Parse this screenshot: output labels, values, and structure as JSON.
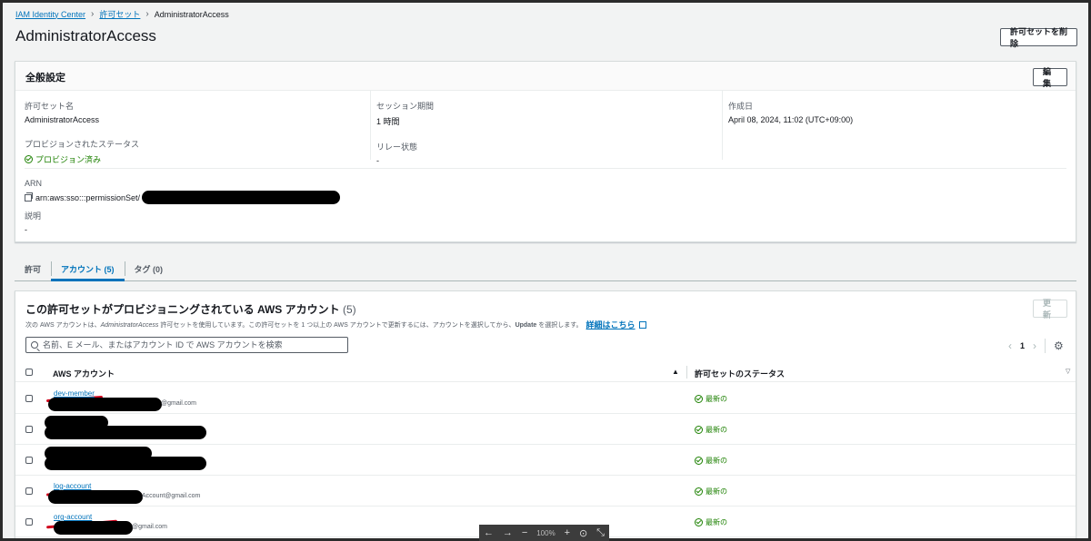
{
  "breadcrumb": {
    "root": "IAM Identity Center",
    "parent": "許可セット",
    "current": "AdministratorAccess"
  },
  "page": {
    "title": "AdministratorAccess",
    "delete_button": "許可セットを削除"
  },
  "general": {
    "title": "全般設定",
    "edit_button": "編集",
    "permission_set_name_label": "許可セット名",
    "permission_set_name": "AdministratorAccess",
    "provisioned_status_label": "プロビジョンされたステータス",
    "provisioned_status": "プロビジョン済み",
    "session_duration_label": "セッション期間",
    "session_duration": "1 時間",
    "relay_state_label": "リレー状態",
    "relay_state": "-",
    "created_label": "作成日",
    "created": "April 08, 2024, 11:02 (UTC+09:00)",
    "arn_label": "ARN",
    "arn_prefix": "arn:aws:sso:::permissionSet/",
    "description_label": "説明",
    "description": "-"
  },
  "tabs": [
    {
      "label": "許可",
      "active": false
    },
    {
      "label": "アカウント (5)",
      "active": true
    },
    {
      "label": "タグ (0)",
      "active": false
    }
  ],
  "accounts": {
    "title": "この許可セットがプロビジョニングされている AWS アカウント",
    "count": "(5)",
    "refresh_button": "更新",
    "desc_before": "次の AWS アカウントは、",
    "desc_name": "AdministratorAccess",
    "desc_after": " 許可セットを使用しています。この許可セットを 1 つ以上の AWS アカウントで更新するには、アカウントを選択してから、",
    "desc_update": "Update",
    "desc_end": " を選択します。",
    "more_link": "詳細はこちら",
    "search_placeholder": "名前、E メール、またはアカウント ID で AWS アカウントを検索",
    "page_number": "1",
    "col_account": "AWS アカウント",
    "col_status": "許可セットのステータス",
    "rows": [
      {
        "name": "dev-member",
        "email": "@gmail.com",
        "status": "最新の"
      },
      {
        "name": "",
        "email": "",
        "status": "最新の"
      },
      {
        "name": "",
        "email": "",
        "status": "最新の"
      },
      {
        "name": "log-account",
        "email": "Account@gmail.com",
        "status": "最新の"
      },
      {
        "name": "org-account",
        "email": "@gmail.com",
        "status": "最新の"
      }
    ]
  },
  "viewer": {
    "zoom": "100%"
  },
  "colors": {
    "link": "#0073bb",
    "success": "#1d8102",
    "annotation": "#d0021b"
  }
}
